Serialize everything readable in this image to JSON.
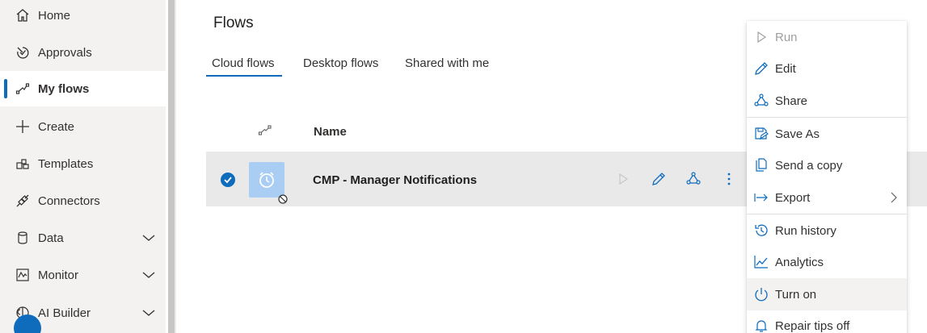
{
  "sidebar": {
    "items": [
      {
        "label": "Home",
        "icon": "home-icon"
      },
      {
        "label": "Approvals",
        "icon": "approvals-icon"
      },
      {
        "label": "My flows",
        "icon": "flows-icon",
        "active": true
      },
      {
        "label": "Create",
        "icon": "plus-icon"
      },
      {
        "label": "Templates",
        "icon": "templates-icon"
      },
      {
        "label": "Connectors",
        "icon": "connectors-icon"
      },
      {
        "label": "Data",
        "icon": "database-icon",
        "expandable": true
      },
      {
        "label": "Monitor",
        "icon": "monitor-icon",
        "expandable": true
      },
      {
        "label": "AI Builder",
        "icon": "ai-builder-icon",
        "expandable": true
      }
    ]
  },
  "main": {
    "title": "Flows",
    "tabs": [
      {
        "label": "Cloud flows",
        "selected": true
      },
      {
        "label": "Desktop flows"
      },
      {
        "label": "Shared with me"
      }
    ],
    "table": {
      "columns": [
        "Name"
      ],
      "rows": [
        {
          "name": "CMP - Manager Notifications",
          "selected": true,
          "status": "off"
        }
      ]
    }
  },
  "context_menu": {
    "items": [
      {
        "label": "Run",
        "icon": "play-icon",
        "disabled": true
      },
      {
        "label": "Edit",
        "icon": "pencil-icon"
      },
      {
        "label": "Share",
        "icon": "share-icon"
      },
      {
        "label": "Save As",
        "icon": "save-as-icon"
      },
      {
        "label": "Send a copy",
        "icon": "copy-icon"
      },
      {
        "label": "Export",
        "icon": "export-icon",
        "submenu": true
      },
      {
        "label": "Run history",
        "icon": "history-icon"
      },
      {
        "label": "Analytics",
        "icon": "analytics-icon"
      },
      {
        "label": "Turn on",
        "icon": "power-icon",
        "hover": true
      },
      {
        "label": "Repair tips off",
        "icon": "bell-icon"
      }
    ]
  },
  "colors": {
    "accent": "#0f6cbd",
    "sidebar_bg": "#f3f2f1",
    "selected_row_bg": "#e9e9e9",
    "thumb_bg": "#a9cdf3"
  }
}
